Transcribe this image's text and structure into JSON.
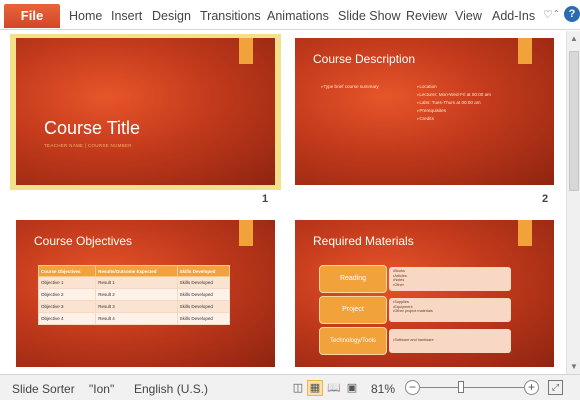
{
  "ribbon": {
    "file_label": "File",
    "tabs": [
      "Home",
      "Insert",
      "Design",
      "Transitions",
      "Animations",
      "Slide Show",
      "Review",
      "View",
      "Add-Ins"
    ],
    "icons": [
      "heart-icon",
      "collapse-ribbon-icon",
      "help-icon"
    ],
    "help_glyph": "?"
  },
  "slides": [
    {
      "number": "1",
      "title": "Course Title",
      "subtitle": "TEACHER NAME | COURSE NUMBER",
      "selected": true
    },
    {
      "number": "2",
      "title": "Course Description",
      "left_bullets": [
        "Type brief course summary"
      ],
      "right_bullets": [
        "Location",
        "Lecturer: Mon-Wed-Fri at 00:00 am",
        "Labs: Tues-Thurs at 00:00 am",
        "Prerequisites",
        "Credits"
      ]
    },
    {
      "number": "3",
      "title": "Course Objectives",
      "table": {
        "headers": [
          "Course Objectives",
          "Results/Outcome Expected",
          "Skills Developed"
        ],
        "rows": [
          [
            "Objective 1",
            "Result 1",
            "Skills Developed"
          ],
          [
            "Objective 2",
            "Result 2",
            "Skills Developed"
          ],
          [
            "Objective 3",
            "Result 3",
            "Skills Developed"
          ],
          [
            "Objective 4",
            "Result 4",
            "Skills Developed"
          ]
        ]
      }
    },
    {
      "number": "4",
      "title": "Required Materials",
      "materials": [
        {
          "label": "Reading",
          "items": [
            "Books",
            "Articles",
            "Notes",
            "Other"
          ]
        },
        {
          "label": "Project",
          "items": [
            "Supplies",
            "Equipment",
            "Other project materials"
          ]
        },
        {
          "label": "Technology/Tools",
          "items": [
            "Software and hardware"
          ]
        }
      ]
    }
  ],
  "statusbar": {
    "view_name": "Slide Sorter",
    "theme": "\"Ion\"",
    "language": "English (U.S.)",
    "zoom": "81%",
    "zoom_minus": "−",
    "zoom_plus": "+"
  },
  "colors": {
    "file_tab": "#d24726",
    "slide_bg": "#c23a1c",
    "accent": "#f2a23a",
    "selection": "#f4df8a"
  }
}
